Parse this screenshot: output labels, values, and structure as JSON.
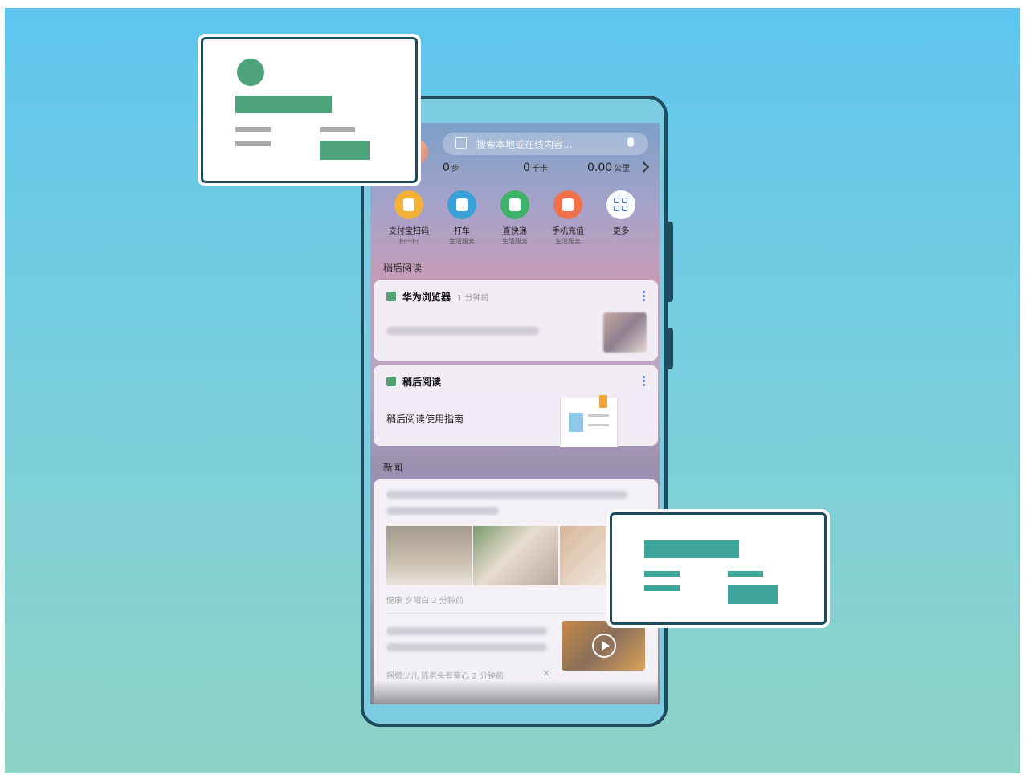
{
  "search": {
    "placeholder": "搜索本地或在线内容..."
  },
  "stats": [
    {
      "value": "0",
      "unit": "步"
    },
    {
      "value": "0",
      "unit": "千卡"
    },
    {
      "value": "0.00",
      "unit": "公里"
    }
  ],
  "shortcuts": [
    {
      "label": "支付宝扫码",
      "sub": "扫一扫",
      "icon": "bus-code-icon",
      "color": "#f3b13a"
    },
    {
      "label": "打车",
      "sub": "生活服务",
      "icon": "taxi-icon",
      "color": "#3aa0d8"
    },
    {
      "label": "查快递",
      "sub": "生活服务",
      "icon": "delivery-truck-icon",
      "color": "#3fb16a"
    },
    {
      "label": "手机充值",
      "sub": "生活服务",
      "icon": "phone-recharge-icon",
      "color": "#f0714b"
    },
    {
      "label": "更多",
      "sub": "",
      "icon": "grid-more-icon",
      "color": "#ffffff"
    }
  ],
  "sections": {
    "read_later": "稍后阅读",
    "news": "新闻"
  },
  "cards": {
    "browser": {
      "title": "华为浏览器",
      "time": "1 分钟前"
    },
    "read_later": {
      "title": "稍后阅读",
      "guide": "稍后阅读使用指南"
    }
  },
  "news": {
    "item1_meta": "健康  夕阳白  2 分钟前",
    "item2_meta": "祸频少儿  陈老头有童心  2 分钟前"
  },
  "colors": {
    "overlay_green": "#4fa37a",
    "overlay_teal": "#3ea59b",
    "outline": "#1e4b5e"
  }
}
